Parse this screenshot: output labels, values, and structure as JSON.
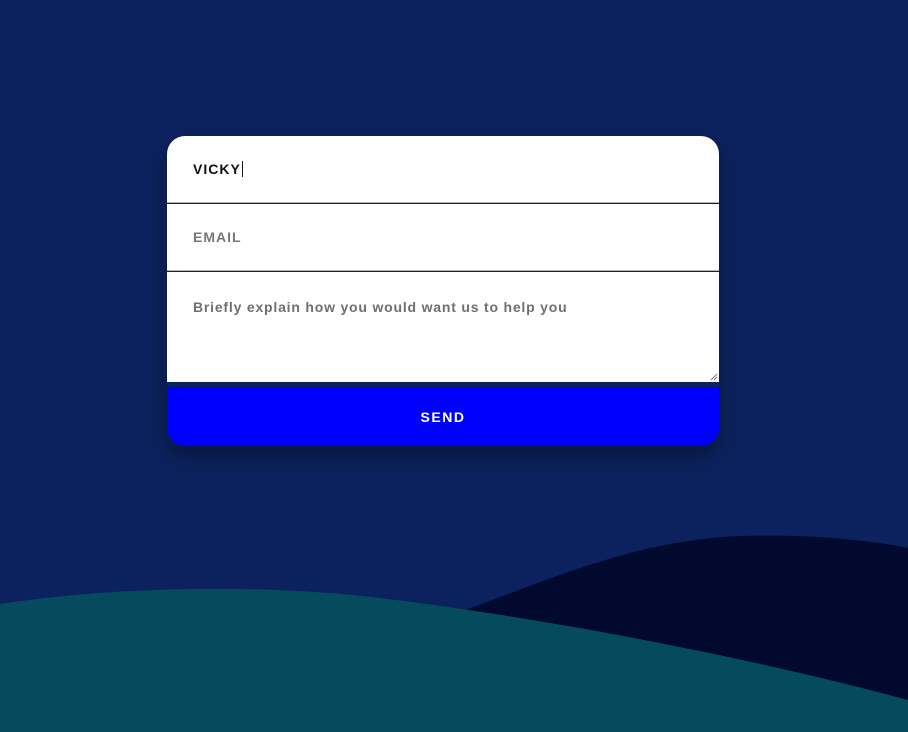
{
  "form": {
    "name_value": "VICKY",
    "email_placeholder": "EMAIL",
    "message_placeholder": "Briefly explain how you would want us to help you",
    "send_label": "SEND"
  },
  "colors": {
    "background": "#0c225e",
    "button": "#0000ff",
    "hill_front": "#064a5d",
    "hill_back": "#010a2e"
  }
}
